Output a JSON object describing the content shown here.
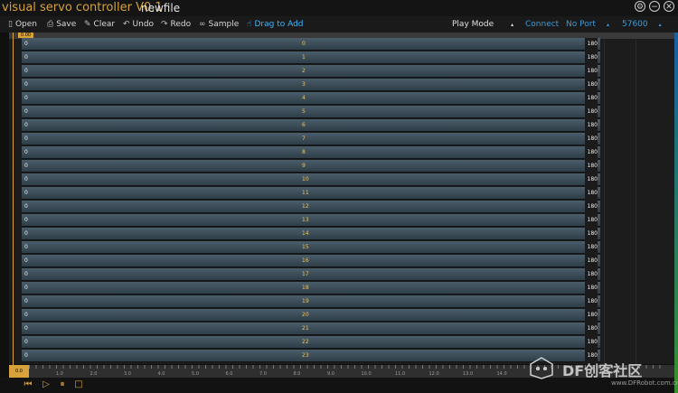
{
  "app": {
    "title": "visual servo controller V0.1",
    "file_name": "newfile"
  },
  "window_controls": [
    {
      "name": "gear-icon",
      "glyph": "⚙"
    },
    {
      "name": "minimize-icon",
      "glyph": "−"
    },
    {
      "name": "close-icon",
      "glyph": "✕"
    }
  ],
  "toolbar": {
    "open": "Open",
    "save": "Save",
    "clear": "Clear",
    "undo": "Undo",
    "redo": "Redo",
    "sample": "Sample",
    "drag": "Drag to Add",
    "play_mode": "Play Mode",
    "connect": "Connect",
    "port": "No Port",
    "baud": "57600"
  },
  "timeline": {
    "time_badge": "0.00",
    "tracks": [
      {
        "min": "0",
        "id": "0",
        "max": "180"
      },
      {
        "min": "0",
        "id": "1",
        "max": "180"
      },
      {
        "min": "0",
        "id": "2",
        "max": "180"
      },
      {
        "min": "0",
        "id": "3",
        "max": "180"
      },
      {
        "min": "0",
        "id": "4",
        "max": "180"
      },
      {
        "min": "0",
        "id": "5",
        "max": "180"
      },
      {
        "min": "0",
        "id": "6",
        "max": "180"
      },
      {
        "min": "0",
        "id": "7",
        "max": "180"
      },
      {
        "min": "0",
        "id": "8",
        "max": "180"
      },
      {
        "min": "0",
        "id": "9",
        "max": "180"
      },
      {
        "min": "0",
        "id": "10",
        "max": "180"
      },
      {
        "min": "0",
        "id": "11",
        "max": "180"
      },
      {
        "min": "0",
        "id": "12",
        "max": "180"
      },
      {
        "min": "0",
        "id": "13",
        "max": "180"
      },
      {
        "min": "0",
        "id": "14",
        "max": "180"
      },
      {
        "min": "0",
        "id": "15",
        "max": "180"
      },
      {
        "min": "0",
        "id": "16",
        "max": "180"
      },
      {
        "min": "0",
        "id": "17",
        "max": "180"
      },
      {
        "min": "0",
        "id": "18",
        "max": "180"
      },
      {
        "min": "0",
        "id": "19",
        "max": "180"
      },
      {
        "min": "0",
        "id": "20",
        "max": "180"
      },
      {
        "min": "0",
        "id": "21",
        "max": "180"
      },
      {
        "min": "0",
        "id": "22",
        "max": "180"
      },
      {
        "min": "0",
        "id": "23",
        "max": "180"
      }
    ]
  },
  "ruler": {
    "start": "0.0",
    "ticks": [
      "1.0",
      "2.0",
      "3.0",
      "4.0",
      "5.0",
      "6.0",
      "7.0",
      "8.0",
      "9.0",
      "10.0",
      "11.0",
      "12.0",
      "13.0",
      "14.0"
    ]
  },
  "playbar": [
    {
      "name": "skip-back-icon",
      "glyph": "⏮"
    },
    {
      "name": "play-icon",
      "glyph": "▷"
    },
    {
      "name": "pause-icon",
      "glyph": "⏸"
    },
    {
      "name": "stop-icon",
      "glyph": "□"
    }
  ],
  "watermark": {
    "text": "DF创客社区",
    "url": "www.DFRobot.com.cn"
  }
}
